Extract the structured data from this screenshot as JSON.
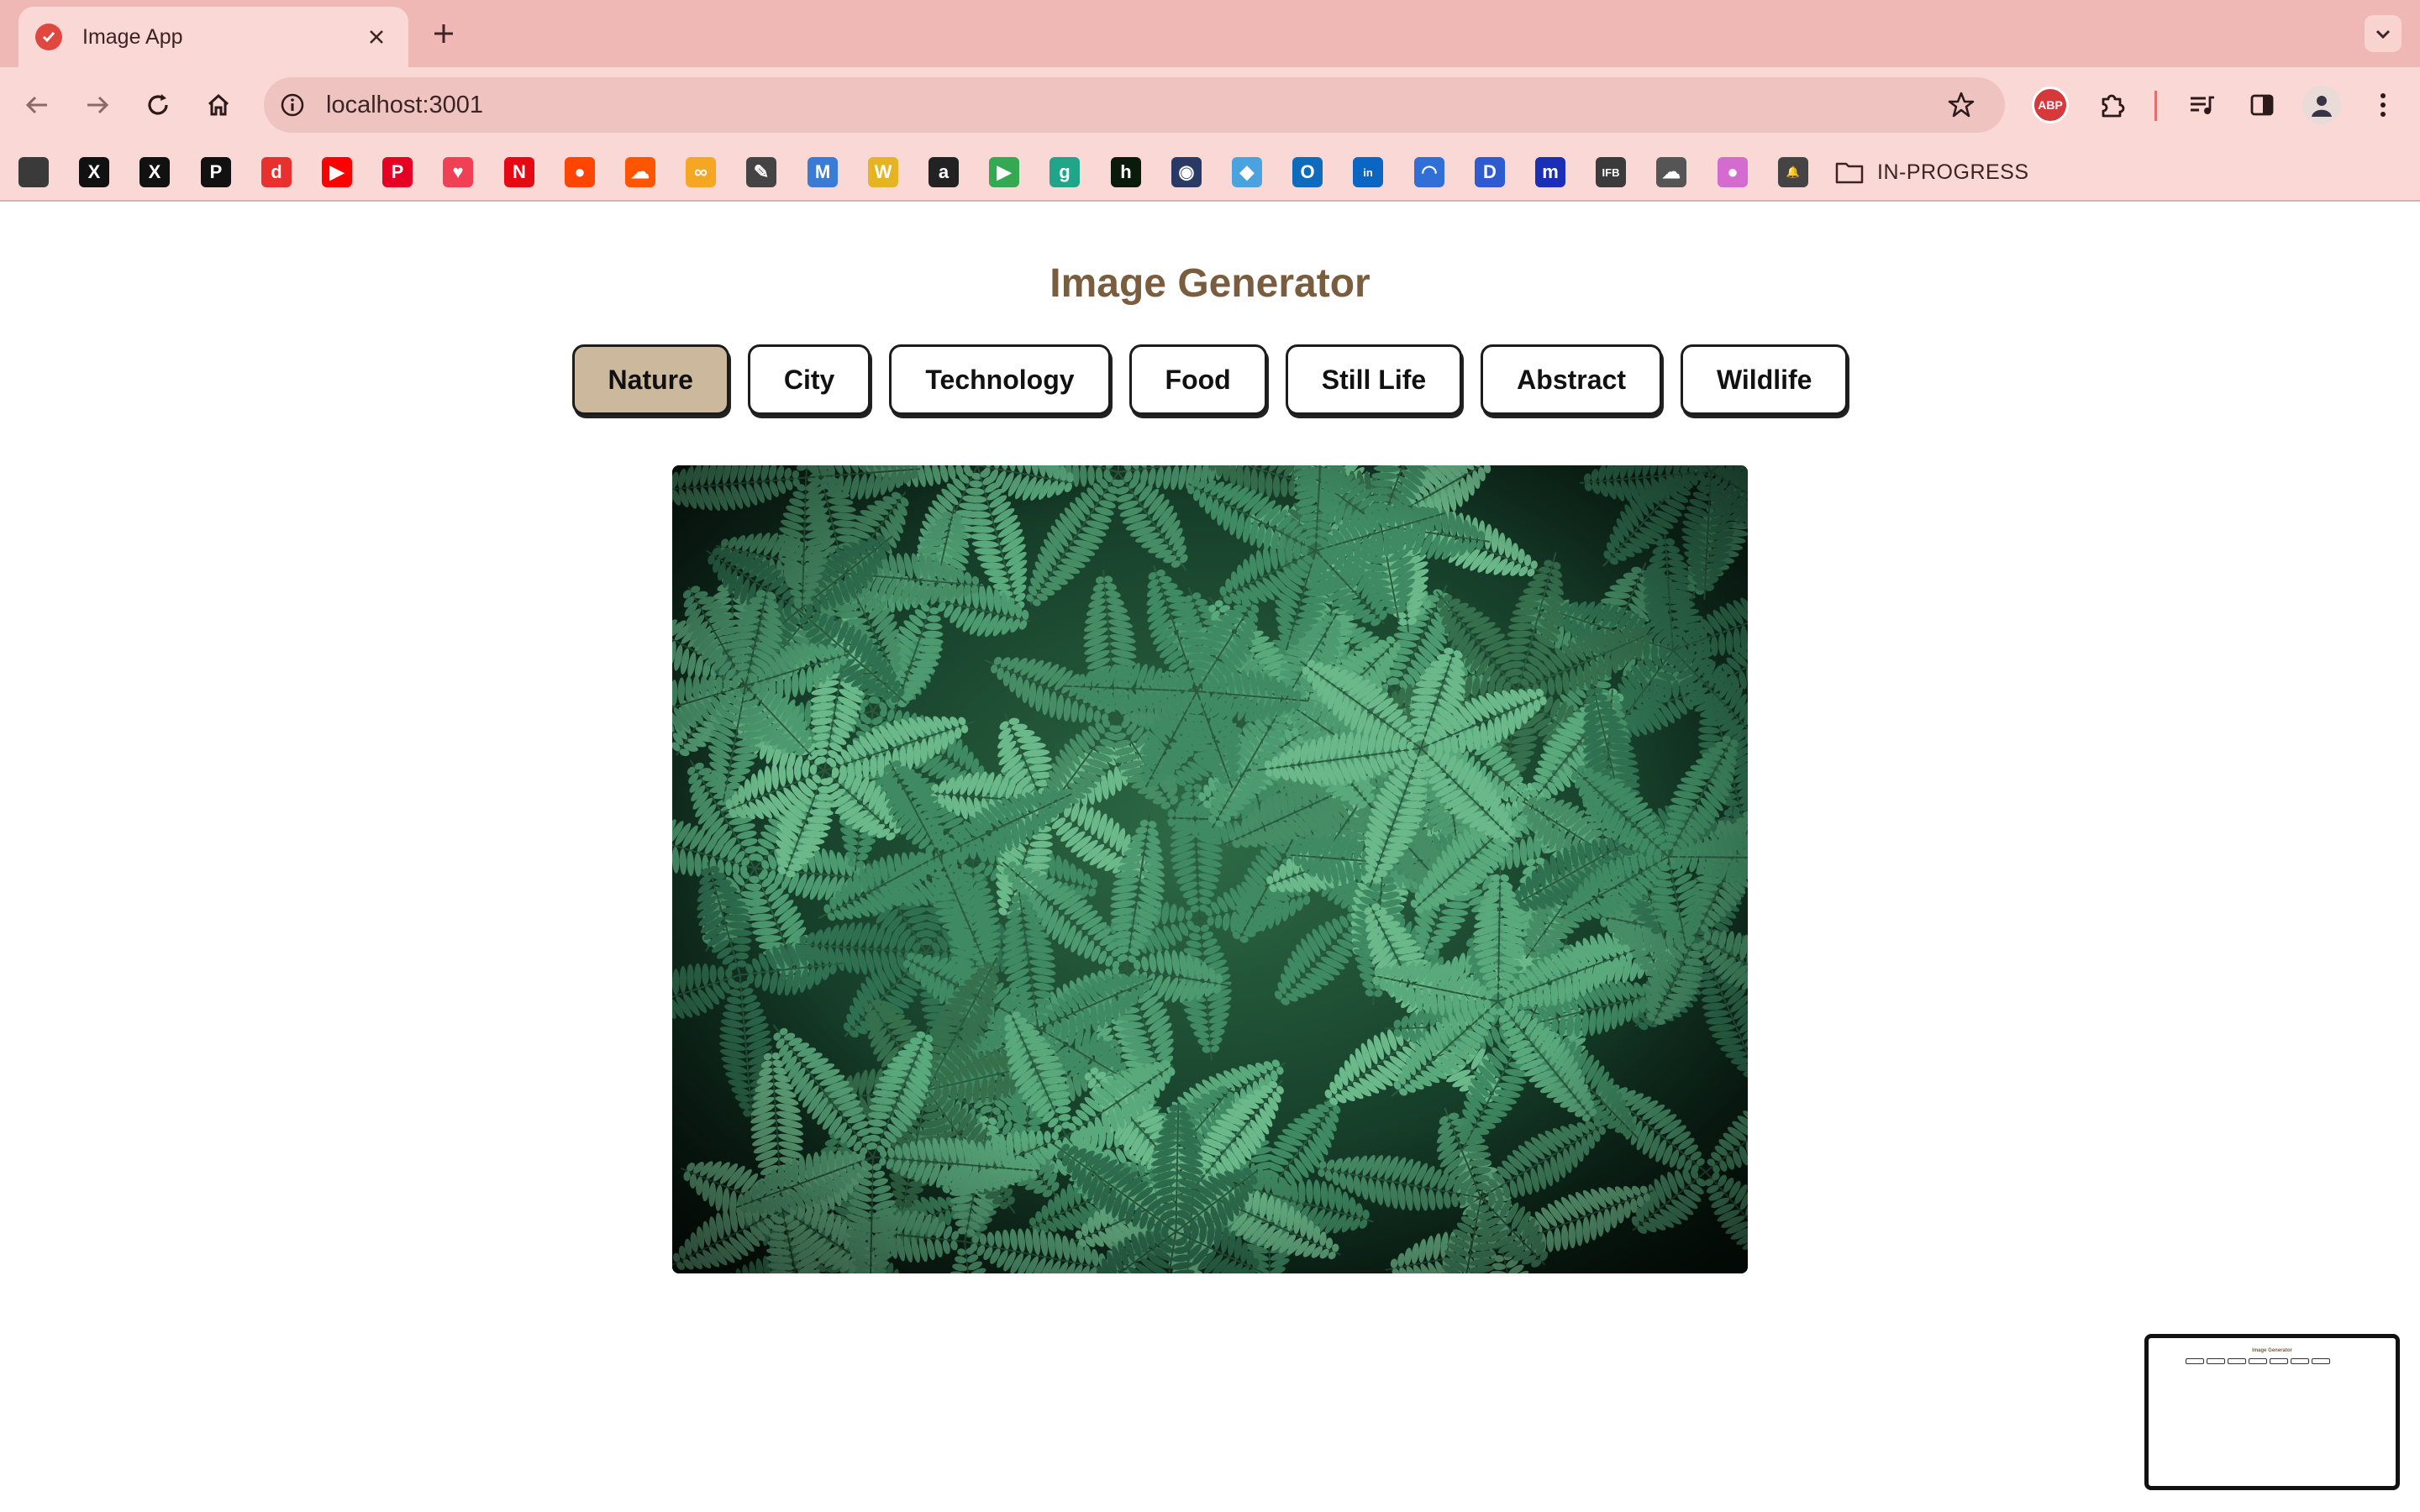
{
  "browser": {
    "tab_title": "Image App",
    "url": "localhost:3001",
    "bookmark_folder": "IN-PROGRESS",
    "bookmarks": [
      {
        "icon": "cube-icon",
        "color": "#3a3a3a",
        "glyph": ""
      },
      {
        "icon": "x-icon",
        "color": "#111111",
        "glyph": "X"
      },
      {
        "icon": "x-icon",
        "color": "#111111",
        "glyph": "X"
      },
      {
        "icon": "p-icon",
        "color": "#111111",
        "glyph": "P"
      },
      {
        "icon": "d-icon",
        "color": "#e8312f",
        "glyph": "d"
      },
      {
        "icon": "youtube-icon",
        "color": "#ff0000",
        "glyph": "▶"
      },
      {
        "icon": "pinterest-icon",
        "color": "#e60023",
        "glyph": "P"
      },
      {
        "icon": "pocket-icon",
        "color": "#ef4056",
        "glyph": "♥"
      },
      {
        "icon": "netflix-icon",
        "color": "#e50914",
        "glyph": "N"
      },
      {
        "icon": "reddit-icon",
        "color": "#ff4500",
        "glyph": "●"
      },
      {
        "icon": "soundcloud-icon",
        "color": "#ff5500",
        "glyph": "☁"
      },
      {
        "icon": "infinity-icon",
        "color": "#f5a623",
        "glyph": "∞"
      },
      {
        "icon": "pen-icon",
        "color": "#444444",
        "glyph": "✎"
      },
      {
        "icon": "m-icon",
        "color": "#3a7bd5",
        "glyph": "M"
      },
      {
        "icon": "w-icon",
        "color": "#e6b422",
        "glyph": "W"
      },
      {
        "icon": "amazon-icon",
        "color": "#222222",
        "glyph": "a"
      },
      {
        "icon": "play-icon",
        "color": "#34a853",
        "glyph": "▶"
      },
      {
        "icon": "g-icon",
        "color": "#20a48a",
        "glyph": "g"
      },
      {
        "icon": "h-icon",
        "color": "#0b1b0b",
        "glyph": "h"
      },
      {
        "icon": "robot-icon",
        "color": "#2a3a66",
        "glyph": "◉"
      },
      {
        "icon": "box-icon",
        "color": "#4aa3df",
        "glyph": "◆"
      },
      {
        "icon": "outlook-icon",
        "color": "#0f6cbd",
        "glyph": "O"
      },
      {
        "icon": "linkedin-icon",
        "color": "#0a66c2",
        "glyph": "in"
      },
      {
        "icon": "arc-icon",
        "color": "#2f6fd6",
        "glyph": "◠"
      },
      {
        "icon": "disney-icon",
        "color": "#2f5bd0",
        "glyph": "D"
      },
      {
        "icon": "m-square-icon",
        "color": "#1a2fb5",
        "glyph": "m"
      },
      {
        "icon": "ifb-icon",
        "color": "#3b3b3b",
        "glyph": "IFB"
      },
      {
        "icon": "cloud-icon",
        "color": "#555555",
        "glyph": "☁"
      },
      {
        "icon": "color-wheel-icon",
        "color": "#d46bd0",
        "glyph": "●"
      },
      {
        "icon": "bell-icon",
        "color": "#444444",
        "glyph": "🔔"
      }
    ]
  },
  "page": {
    "title": "Image Generator",
    "categories": [
      "Nature",
      "City",
      "Technology",
      "Food",
      "Still Life",
      "Abstract",
      "Wildlife"
    ],
    "active_category": "Nature",
    "image_subject": "green fern leaves"
  },
  "colors": {
    "tabstrip": "#f0b8b5",
    "toolbar": "#fad8d6",
    "title": "#7a5c3e",
    "active_button": "#ccb89d"
  }
}
